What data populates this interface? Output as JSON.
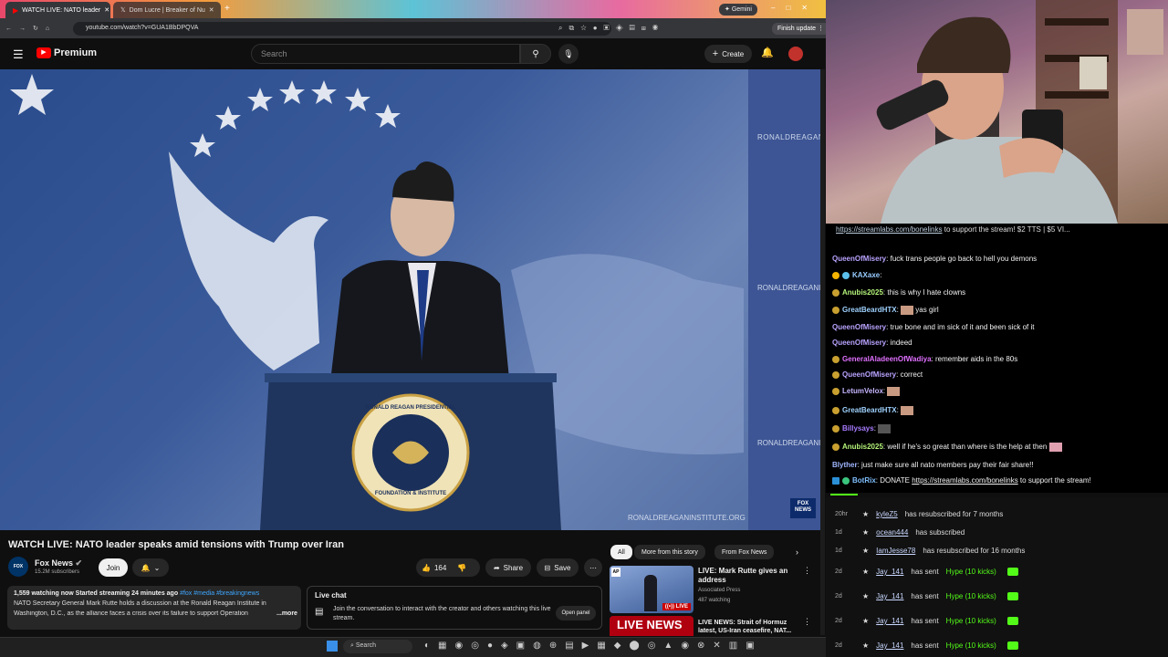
{
  "browser": {
    "tabs": [
      {
        "label": "WATCH LIVE: NATO leader",
        "active": true
      },
      {
        "label": "Dom Lucre | Breaker of Nu",
        "active": false
      }
    ],
    "gemini_label": "Gemini",
    "url": "youtube.com/watch?v=GUA1BbDPQVA",
    "finish_update": "Finish update"
  },
  "youtube": {
    "logo_text": "Premium",
    "search_placeholder": "Search",
    "create_label": "Create",
    "video_title": "WATCH LIVE: NATO leader speaks amid tensions with Trump over Iran",
    "channel_name": "Fox News",
    "subscribers": "15.2M subscribers",
    "join_label": "Join",
    "likes": "164",
    "share_label": "Share",
    "save_label": "Save",
    "desc_stats": "1,559 watching now  Started streaming 24 minutes ago",
    "desc_tags": "#fox #media #breakingnews",
    "desc_line1": "NATO Secretary General Mark Rutte holds a discussion at the Ronald Reagan Institute in",
    "desc_line2": "Washington, D.C., as the alliance faces a crisis over its failure to support Operation",
    "more_label": "...more",
    "livechat_title": "Live chat",
    "livechat_text": "Join the conversation to interact with the creator and others watching this live stream.",
    "open_panel": "Open panel",
    "chips": [
      "All",
      "More from this story",
      "From Fox News"
    ],
    "rec1_title": "LIVE: Mark Rutte gives an address",
    "rec1_channel": "Associated Press",
    "rec1_meta": "487 watching",
    "rec1_badge": "LIVE",
    "rec2_title": "LIVE NEWS: Strait of Hormuz latest, US-Iran ceasefire, NAT...",
    "rec2_thumb_text": "LIVE NEWS",
    "watermark": "RONALDREAGANINSTITUTE.ORG",
    "side_text": "RONALDREAGANIN",
    "seal_top": "RONALD REAGAN PRESIDENTIAL",
    "seal_bottom": "FOUNDATION & INSTITUTE",
    "fox_bug": "FOX NEWS"
  },
  "chat": {
    "top_link": "https://streamlabs.com/bonelinks",
    "top_rest": " to support the stream! $2 TTS | $5 VI...",
    "messages": [
      {
        "user": "QueenOfMisery",
        "color": "#b9a3ff",
        "text": "fuck trans people go back to hell you demons",
        "badge": false
      },
      {
        "user": "KAXaxe",
        "color": "#9cf",
        "text": "",
        "badge": true
      },
      {
        "user": "Anubis2025",
        "color": "#b6f57a",
        "text": "this is why I hate clowns",
        "badge": true
      },
      {
        "user": "GreatBeardHTX",
        "color": "#9fd2ff",
        "text": "yas girl",
        "badge": true
      },
      {
        "user": "QueenOfMisery",
        "color": "#b9a3ff",
        "text": "true bone and im sick of it and been sick of it",
        "badge": false
      },
      {
        "user": "QueenOfMisery",
        "color": "#b9a3ff",
        "text": "indeed",
        "badge": false
      },
      {
        "user": "GeneralAladeenOfWadiya",
        "color": "#e070ff",
        "text": "remember aids in the 80s",
        "badge": true
      },
      {
        "user": "QueenOfMisery",
        "color": "#b9a3ff",
        "text": "correct",
        "badge": true
      },
      {
        "user": "LetumVelox",
        "color": "#c6b5ff",
        "text": "",
        "badge": true
      },
      {
        "user": "GreatBeardHTX",
        "color": "#9fd2ff",
        "text": "",
        "badge": true
      },
      {
        "user": "Billysays",
        "color": "#a77cff",
        "text": "",
        "badge": true
      },
      {
        "user": "Anubis2025",
        "color": "#b6f57a",
        "text": "well if he's so great than where is the help at then",
        "badge": true
      },
      {
        "user": "Blyther",
        "color": "#a0b6ff",
        "text": "just make sure all nato members pay their fair share!!",
        "badge": false
      }
    ],
    "bot_user": "BotRix",
    "bot_text_pre": "DONATE ",
    "bot_link": "https://streamlabs.com/bonelinks",
    "bot_text_post": " to support the stream!"
  },
  "events": [
    {
      "time": "20hr",
      "name": "kyleZ5",
      "text": "has resubscribed for 7 months",
      "kick": false
    },
    {
      "time": "1d",
      "name": "ocean444",
      "text": "has subscribed",
      "kick": false
    },
    {
      "time": "1d",
      "name": "IamJesse78",
      "text": "has resubscribed for 16 months",
      "kick": false
    },
    {
      "time": "2d",
      "name": "Jay_141",
      "text": "has sent",
      "hype": "Hype (10 kicks)",
      "kick": true
    },
    {
      "time": "2d",
      "name": "Jay_141",
      "text": "has sent",
      "hype": "Hype (10 kicks)",
      "kick": true
    },
    {
      "time": "2d",
      "name": "Jay_141",
      "text": "has sent",
      "hype": "Hype (10 kicks)",
      "kick": true
    },
    {
      "time": "2d",
      "name": "Jay_141",
      "text": "has sent",
      "hype": "Hype (10 kicks)",
      "kick": true
    }
  ],
  "taskbar": {
    "search_label": "Search"
  }
}
